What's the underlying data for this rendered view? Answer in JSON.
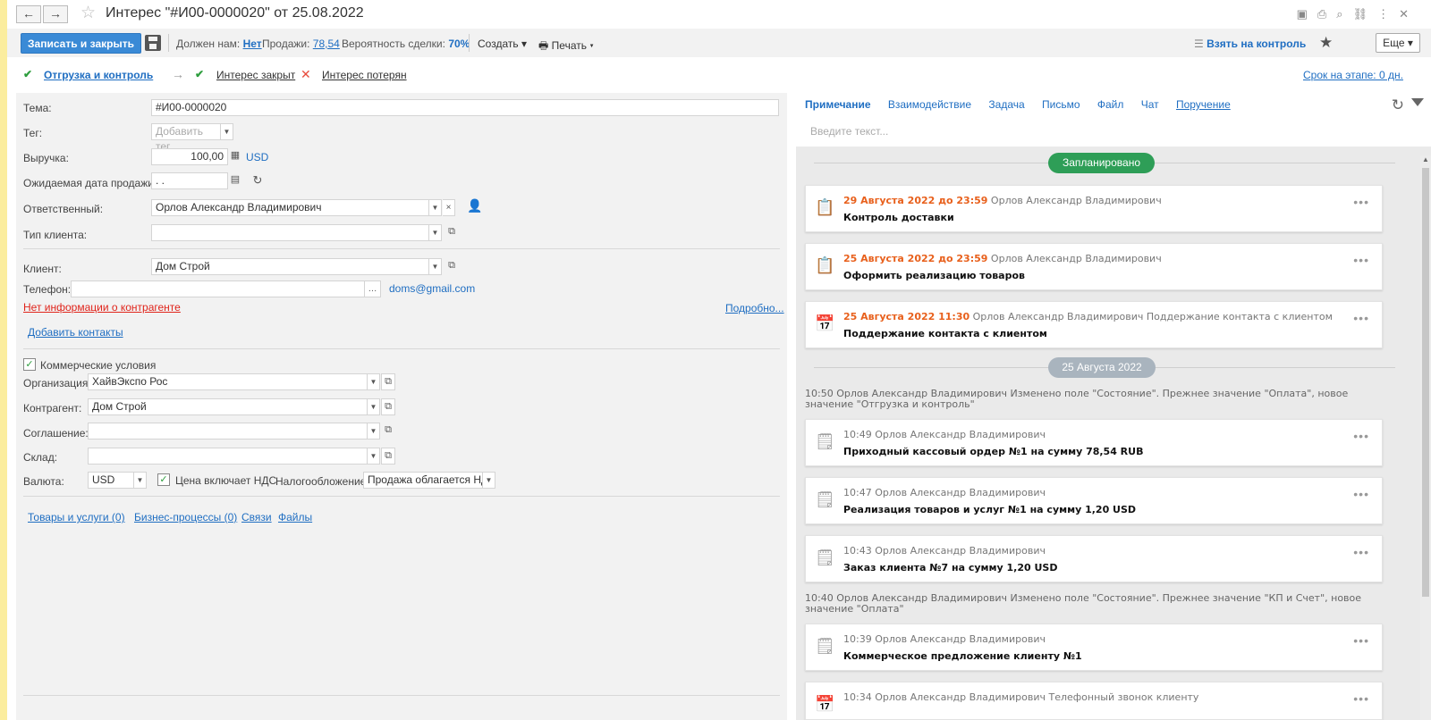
{
  "title": "Интерес \"#И00-0000020\" от 25.08.2022",
  "nav": {
    "back": "←",
    "forward": "→"
  },
  "toolbar": {
    "save_close": "Записать и закрыть",
    "owed_label": "Должен нам:",
    "owed_value": "Нет",
    "sales_label": "Продажи:",
    "sales_value": "78,54",
    "prob_label": "Вероятность сделки:",
    "prob_value": "70%",
    "create": "Создать",
    "print": "Печать",
    "control": "Взять на контроль",
    "more": "Еще"
  },
  "stages": {
    "current": "Отгрузка и контроль",
    "closed": "Интерес закрыт",
    "lost": "Интерес потерян",
    "term": "Срок на этапе: 0 дн."
  },
  "form": {
    "topic_label": "Тема:",
    "topic": "#И00-0000020",
    "tag_label": "Тег:",
    "tag_placeholder": "Добавить тег",
    "revenue_label": "Выручка:",
    "revenue": "100,00",
    "currency_link": "USD",
    "date_label": "Ожидаемая дата продажи:",
    "date": " .  .",
    "resp_label": "Ответственный:",
    "resp": "Орлов Александр Владимирович",
    "client_type_label": "Тип клиента:",
    "client_label": "Клиент:",
    "client": "Дом Строй",
    "phone_label": "Телефон:",
    "email": "doms@gmail.com",
    "no_info": "Нет информации о контрагенте",
    "details": "Подробно...",
    "add_contacts": "Добавить контакты",
    "commercial": "Коммерческие условия",
    "org_label": "Организация:",
    "org": "ХайвЭкспо Рос",
    "contr_label": "Контрагент:",
    "contr": "Дом Строй",
    "agree_label": "Соглашение:",
    "warehouse_label": "Склад:",
    "currency_label": "Валюта:",
    "currency": "USD",
    "vat_incl": "Цена включает НДС",
    "tax_label": "Налогообложение:",
    "tax": "Продажа облагается НДС",
    "links": [
      "Товары и услуги (0)",
      "Бизнес-процессы (0)",
      "Связи",
      "Файлы"
    ]
  },
  "feed": {
    "tabs": [
      "Примечание",
      "Взаимодействие",
      "Задача",
      "Письмо",
      "Файл",
      "Чат",
      "Поручение"
    ],
    "input_placeholder": "Введите текст...",
    "planned": "Запланировано",
    "date_group": "25 Августа 2022",
    "cards": [
      {
        "when": "29 Августа 2022 до 23:59",
        "who": "Орлов Александр Владимирович",
        "text": "Контроль доставки"
      },
      {
        "when": "25 Августа 2022 до 23:59",
        "who": "Орлов Александр Владимирович",
        "text": "Оформить реализацию товаров"
      },
      {
        "when": "25 Августа 2022 11:30",
        "who": "Орлов Александр Владимирович Поддержание контакта с клиентом",
        "text": "Поддержание контакта с клиентом"
      }
    ],
    "note1": "10:50 Орлов Александр Владимирович Изменено поле \"Состояние\". Прежнее значение \"Оплата\", новое значение \"Отгрузка и контроль\"",
    "docs": [
      {
        "meta": "10:49 Орлов Александр Владимирович",
        "text": "Приходный кассовый ордер №1 на сумму 78,54 RUB"
      },
      {
        "meta": "10:47 Орлов Александр Владимирович",
        "text": "Реализация товаров и услуг №1 на сумму 1,20 USD"
      },
      {
        "meta": "10:43 Орлов Александр Владимирович",
        "text": "Заказ клиента №7 на сумму 1,20 USD"
      }
    ],
    "note2": "10:40 Орлов Александр Владимирович Изменено поле \"Состояние\". Прежнее значение \"КП и Счет\", новое значение \"Оплата\"",
    "doc4": {
      "meta": "10:39 Орлов Александр Владимирович",
      "text": "Коммерческое предложение клиенту №1"
    },
    "doc5": {
      "meta": "10:34 Орлов Александр Владимирович Телефонный звонок клиенту"
    }
  },
  "colors": {
    "accent": "#3a8ad6",
    "link": "#1f6ec2",
    "planned": "#2e9e57",
    "date_pill": "#a9b4be",
    "overdue": "#e8601c"
  }
}
